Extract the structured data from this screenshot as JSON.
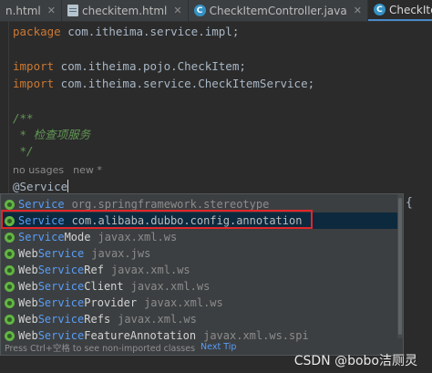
{
  "tabs": [
    {
      "label": "n.html",
      "icon": "html-file-icon",
      "active": false
    },
    {
      "label": "checkitem.html",
      "icon": "html-file-icon",
      "active": false
    },
    {
      "label": "CheckItemController.java",
      "icon": "java-class-icon",
      "active": false
    },
    {
      "label": "CheckItemServiceImpl",
      "icon": "java-class-icon",
      "active": true
    }
  ],
  "editor": {
    "lines": {
      "package_kw": "package",
      "package_name": " com.itheima.service.impl;",
      "import1_kw": "import",
      "import1_name": " com.itheima.pojo.CheckItem;",
      "import2_kw": "import",
      "import2_name": " com.itheima.service.CheckItemService;",
      "doc_open": "/**",
      "doc_body": " * 检查项服务",
      "doc_close": " */",
      "annotation": "@Service"
    },
    "inlay_usages": "no usages",
    "inlay_author": "new *",
    "brace": "{"
  },
  "completion": {
    "items": [
      {
        "match": "Service",
        "rest": "",
        "package": "org.springframework.stereotype",
        "selected": false
      },
      {
        "match": "Service",
        "rest": "",
        "package": "com.alibaba.dubbo.config.annotation",
        "selected": true
      },
      {
        "match": "Service",
        "rest": "Mode",
        "package": "javax.xml.ws",
        "selected": false
      },
      {
        "prefix": "Web",
        "match": "Service",
        "rest": "",
        "package": "javax.jws",
        "selected": false
      },
      {
        "prefix": "Web",
        "match": "Service",
        "rest": "Ref",
        "package": "javax.xml.ws",
        "selected": false
      },
      {
        "prefix": "Web",
        "match": "Service",
        "rest": "Client",
        "package": "javax.xml.ws",
        "selected": false
      },
      {
        "prefix": "Web",
        "match": "Service",
        "rest": "Provider",
        "package": "javax.xml.ws",
        "selected": false
      },
      {
        "prefix": "Web",
        "match": "Service",
        "rest": "Refs",
        "package": "javax.xml.ws",
        "selected": false
      },
      {
        "prefix": "Web",
        "match": "Service",
        "rest": "FeatureAnnotation",
        "package": "javax.xml.ws.spi",
        "selected": false
      }
    ],
    "footer_text": "Press Ctrl+空格 to see non-imported classes",
    "footer_link": "Next Tip"
  },
  "watermark": "CSDN @bobo洁厕灵",
  "colors": {
    "keyword": "#cc7832",
    "comment": "#629755",
    "annotation": "#bbb529",
    "match_highlight": "#589df6",
    "selection": "#0d293e",
    "red_highlight_box": "#e0262b"
  }
}
